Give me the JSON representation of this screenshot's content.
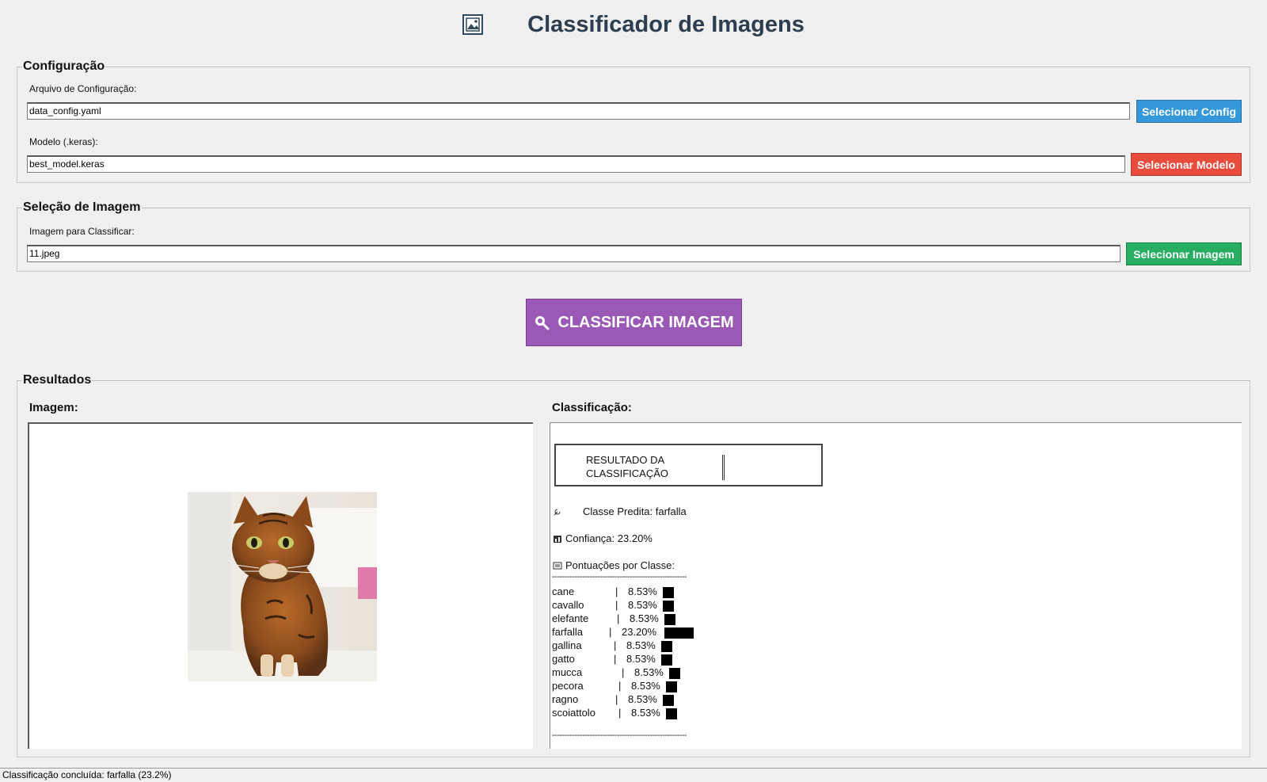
{
  "app": {
    "title": "Classificador de Imagens",
    "icon": "framed-picture-icon"
  },
  "config_section": {
    "legend": "Configuração",
    "config_file": {
      "label": "Arquivo de Configuração:",
      "value": "data_config.yaml",
      "button_label": "Selecionar Config",
      "button_color": "#3498db"
    },
    "model_file": {
      "label": "Modelo (.keras):",
      "value": "best_model.keras",
      "button_label": "Selecionar Modelo",
      "button_color": "#e74c3c"
    }
  },
  "image_section": {
    "legend": "Seleção de Imagem",
    "label": "Imagem para Classificar:",
    "value": "11.jpeg",
    "button_label": "Selecionar Imagem",
    "button_color": "#27ae60"
  },
  "classify_button": {
    "label": "CLASSIFICAR IMAGEM",
    "icon": "magnifier-icon",
    "color": "#9b59b6"
  },
  "results": {
    "legend": "Resultados",
    "image_heading": "Imagem:",
    "classification_heading": "Classificação:",
    "image_subject": "cat-photo",
    "result_box": {
      "line1": "RESULTADO DA",
      "line2": "CLASSIFICAÇÃO"
    },
    "predicted_class_label": "Classe Predita: farfalla",
    "confidence_label": "Confiança: 23.20%",
    "scores_label": "Pontuações por Classe:",
    "divider": "--------------------------------------------------------",
    "scores": [
      {
        "name": "cane",
        "pct": "8.53%",
        "value": 8.53
      },
      {
        "name": "cavallo",
        "pct": "8.53%",
        "value": 8.53
      },
      {
        "name": "elefante",
        "pct": "8.53%",
        "value": 8.53
      },
      {
        "name": "farfalla",
        "pct": "23.20%",
        "value": 23.2
      },
      {
        "name": "gallina",
        "pct": "8.53%",
        "value": 8.53
      },
      {
        "name": "gatto",
        "pct": "8.53%",
        "value": 8.53
      },
      {
        "name": "mucca",
        "pct": "8.53%",
        "value": 8.53
      },
      {
        "name": "pecora",
        "pct": "8.53%",
        "value": 8.53
      },
      {
        "name": "ragno",
        "pct": "8.53%",
        "value": 8.53
      },
      {
        "name": "scoiattolo",
        "pct": "8.53%",
        "value": 8.53
      }
    ]
  },
  "status_bar": {
    "text": "Classificação concluída: farfalla (23.2%)"
  }
}
